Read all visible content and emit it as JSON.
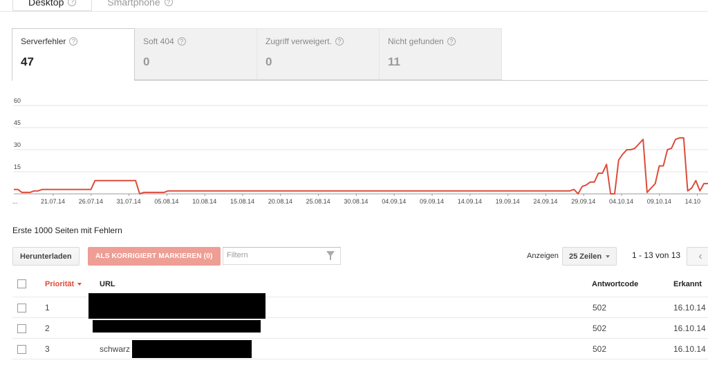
{
  "device_tabs": [
    {
      "label": "Desktop",
      "active": true
    },
    {
      "label": "Smartphone",
      "active": false
    }
  ],
  "metrics": [
    {
      "label": "Serverfehler",
      "value": "47",
      "active": true
    },
    {
      "label": "Soft 404",
      "value": "0",
      "active": false
    },
    {
      "label": "Zugriff verweigert.",
      "value": "0",
      "active": false
    },
    {
      "label": "Nicht gefunden",
      "value": "11",
      "active": false
    }
  ],
  "chart_data": {
    "type": "line",
    "title": "",
    "xlabel": "",
    "ylabel": "",
    "ylim": [
      0,
      60
    ],
    "y_ticks": [
      "60",
      "45",
      "30",
      "15"
    ],
    "x_tick_labels": [
      "...",
      "21.07.14",
      "26.07.14",
      "31.07.14",
      "05.08.14",
      "10.08.14",
      "15.08.14",
      "20.08.14",
      "25.08.14",
      "30.08.14",
      "04.09.14",
      "09.09.14",
      "14.09.14",
      "19.09.14",
      "24.09.14",
      "29.09.14",
      "04.10.14",
      "09.10.14",
      "14.10"
    ],
    "grid": true,
    "color": "#dd4b39",
    "series": [
      {
        "values": [
          3,
          3,
          1,
          1,
          1,
          2,
          2,
          3,
          3,
          3,
          3,
          3,
          3,
          3,
          3,
          3,
          3,
          3,
          3,
          3,
          9,
          9,
          9,
          9,
          9,
          9,
          9,
          9,
          9,
          9,
          9,
          0,
          1,
          1,
          1,
          1,
          1,
          1,
          2,
          2,
          2,
          2,
          2,
          2,
          2,
          2,
          2,
          2,
          2,
          2,
          2,
          2,
          2,
          2,
          2,
          2,
          2,
          2,
          2,
          2,
          2,
          2,
          2,
          2,
          2,
          2,
          2,
          2,
          2,
          2,
          2,
          2,
          2,
          2,
          2,
          2,
          2,
          2,
          2,
          2,
          2,
          2,
          2,
          2,
          2,
          2,
          2,
          2,
          2,
          2,
          2,
          2,
          2,
          2,
          2,
          2,
          2,
          2,
          2,
          2,
          2,
          2,
          2,
          2,
          2,
          2,
          2,
          2,
          2,
          2,
          2,
          2,
          2,
          2,
          2,
          2,
          2,
          2,
          2,
          2,
          2,
          2,
          2,
          2,
          2,
          2,
          2,
          2,
          2,
          2,
          2,
          2,
          2,
          2,
          2,
          2,
          2,
          2,
          3,
          0,
          5,
          6,
          8,
          8,
          14,
          14,
          20,
          0,
          0,
          23,
          27,
          30,
          30,
          31,
          34,
          37,
          1,
          4,
          7,
          19,
          19,
          30,
          31,
          37,
          38,
          38,
          2,
          4,
          9,
          2,
          7,
          7
        ]
      }
    ]
  },
  "section_title": "Erste 1000 Seiten mit Fehlern",
  "toolbar": {
    "download_label": "Herunterladen",
    "mark_fixed_label": "ALS KORRIGIERT MARKIEREN (0)",
    "filter_placeholder": "Filtern",
    "show_label": "Anzeigen",
    "rows_value": "25 Zeilen",
    "pager_text": "1 - 13 von 13"
  },
  "table": {
    "headers": {
      "priority": "Priorität",
      "url": "URL",
      "response": "Antwortcode",
      "detected": "Erkannt"
    },
    "rows": [
      {
        "priority": "1",
        "url": "",
        "response": "502",
        "detected": "16.10.14"
      },
      {
        "priority": "2",
        "url": "",
        "response": "502",
        "detected": "16.10.14"
      },
      {
        "priority": "3",
        "url": "schwarz",
        "response": "502",
        "detected": "16.10.14"
      }
    ]
  }
}
